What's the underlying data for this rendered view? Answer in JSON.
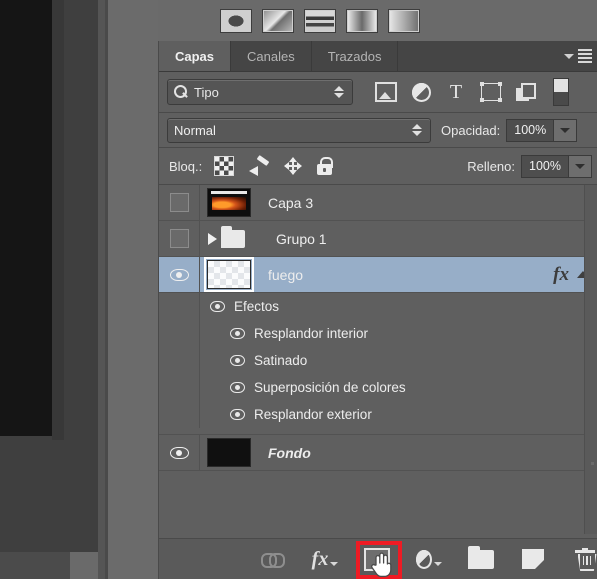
{
  "app": {
    "panel_title": "Capas"
  },
  "gradient_presets": {
    "label": "gradient-presets-strip",
    "items": [
      "radial-gradient-preset",
      "diagonal-gradient-preset",
      "wave-gradient-preset",
      "reflected-gradient-preset",
      "linear-gradient-preset"
    ]
  },
  "tabs": [
    {
      "label": "Capas",
      "active": true
    },
    {
      "label": "Canales",
      "active": false
    },
    {
      "label": "Trazados",
      "active": false
    }
  ],
  "filter": {
    "type_label": "Tipo",
    "icons": [
      "pixel-layer-filter-icon",
      "adjustment-layer-filter-icon",
      "type-layer-filter-icon",
      "shape-layer-filter-icon",
      "smart-object-filter-icon"
    ],
    "toggle_name": "filter-enable-toggle"
  },
  "blend": {
    "mode": "Normal",
    "opacity_label": "Opacidad:",
    "opacity_value": "100%",
    "fill_label": "Relleno:",
    "fill_value": "100%"
  },
  "lock": {
    "label": "Bloq.:",
    "icons": [
      "lock-transparent-pixels-icon",
      "lock-image-pixels-icon",
      "lock-position-icon",
      "lock-all-icon"
    ]
  },
  "layers": [
    {
      "name": "Capa 3",
      "visible": false,
      "selected": false,
      "thumb": "fire-text-thumbnail",
      "kind": "pixel"
    },
    {
      "name": "Grupo 1",
      "visible": false,
      "selected": false,
      "thumb": "folder-thumbnail",
      "kind": "group",
      "expanded": false
    },
    {
      "name": "fuego",
      "visible": true,
      "selected": true,
      "thumb": "transparent-checker-thumbnail",
      "kind": "pixel",
      "fx_badge": "fx",
      "effects_group_label": "Efectos",
      "effects": [
        "Resplandor interior",
        "Satinado",
        "Superposición de colores",
        "Resplandor exterior"
      ]
    },
    {
      "name": "Fondo",
      "visible": true,
      "selected": false,
      "thumb": "black-thumbnail",
      "kind": "background",
      "locked": true,
      "italic": true
    }
  ],
  "bottom_toolbar": {
    "buttons": [
      {
        "name": "link-layers-button",
        "icon": "link-icon",
        "label": ""
      },
      {
        "name": "layer-style-button",
        "icon": "fx-icon",
        "label": "fx"
      },
      {
        "name": "add-layer-mask-button",
        "icon": "mask-icon",
        "label": "",
        "highlighted": true
      },
      {
        "name": "new-adjustment-layer-button",
        "icon": "adjustment-icon",
        "label": ""
      },
      {
        "name": "new-group-button",
        "icon": "folder-icon",
        "label": ""
      },
      {
        "name": "new-layer-button",
        "icon": "new-layer-icon",
        "label": ""
      },
      {
        "name": "delete-layer-button",
        "icon": "trash-icon",
        "label": ""
      }
    ]
  },
  "annotation": {
    "highlight_color": "#ee1b24",
    "target": "add-layer-mask-button",
    "cursor": "hand-cursor"
  },
  "colors": {
    "panel_bg": "#5f5f5f",
    "tabbar_bg": "#454545",
    "selected_row": "#97aec8",
    "toolbar_bg": "#5a5a5a",
    "text": "#ededed"
  }
}
